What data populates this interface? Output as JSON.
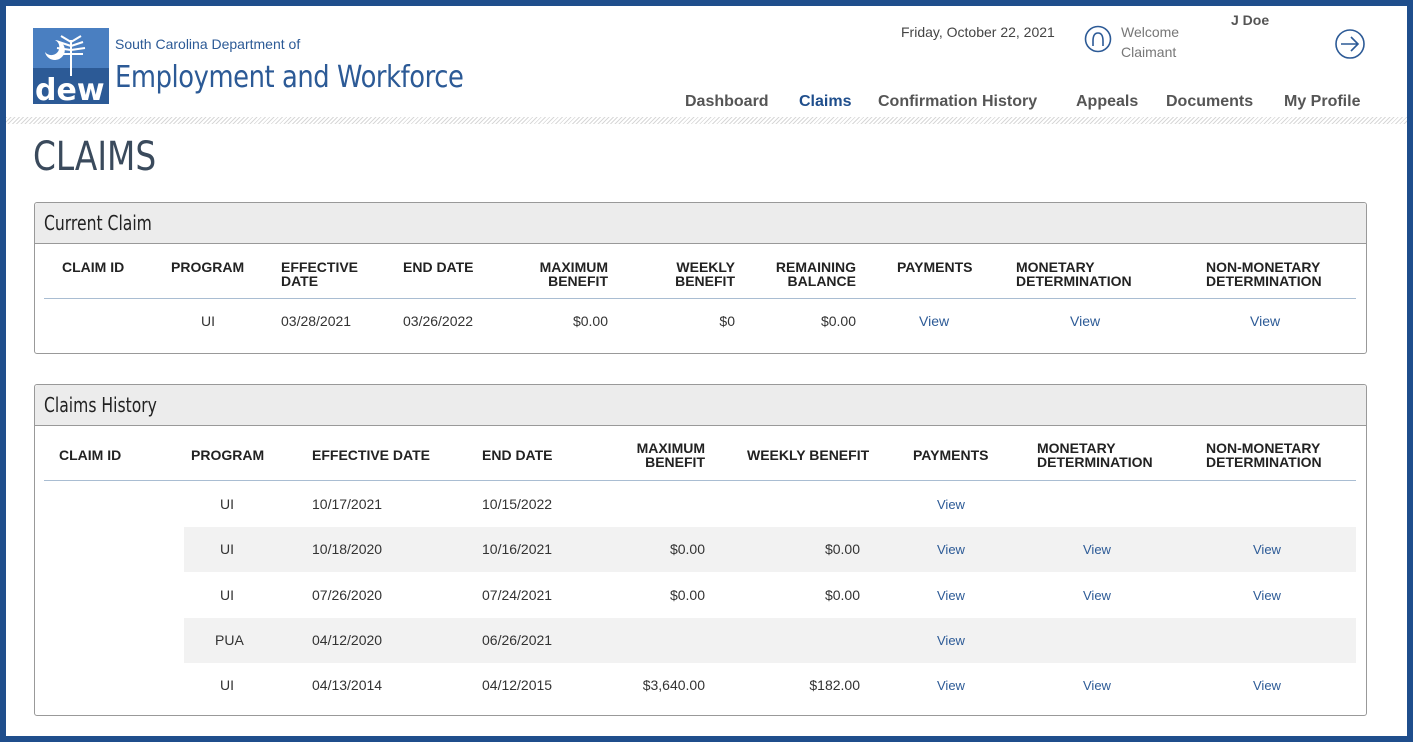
{
  "header": {
    "agency_line1": "South Carolina Department of",
    "agency_line2": "Employment and Workforce",
    "logo_text": "dew",
    "date": "Friday, October 22, 2021",
    "welcome": "Welcome",
    "role": "Claimant",
    "username": "J Doe",
    "icons": {
      "user": "user-circle-icon",
      "logout": "logout-arrow-icon"
    }
  },
  "nav": [
    {
      "label": "Dashboard",
      "active": false
    },
    {
      "label": "Claims",
      "active": true
    },
    {
      "label": "Confirmation History",
      "active": false
    },
    {
      "label": "Appeals",
      "active": false
    },
    {
      "label": "Documents",
      "active": false
    },
    {
      "label": "My Profile",
      "active": false
    }
  ],
  "page_title": "CLAIMS",
  "current_claim": {
    "title": "Current Claim",
    "headers": [
      "CLAIM ID",
      "PROGRAM",
      "EFFECTIVE DATE",
      "END DATE",
      "MAXIMUM BENEFIT",
      "WEEKLY BENEFIT",
      "REMAINING BALANCE",
      "PAYMENTS",
      "MONETARY DETERMINATION",
      "NON-MONETARY DETERMINATION"
    ],
    "header_lines": {
      "effective": [
        "EFFECTIVE",
        "DATE"
      ],
      "maximum": [
        "MAXIMUM",
        "BENEFIT"
      ],
      "weekly": [
        "WEEKLY",
        "BENEFIT"
      ],
      "remaining": [
        "REMAINING",
        "BALANCE"
      ],
      "monetary": [
        "MONETARY",
        "DETERMINATION"
      ],
      "nonmonetary": [
        "NON-MONETARY",
        "DETERMINATION"
      ]
    },
    "row": {
      "claim_id": "",
      "program": "UI",
      "effective_date": "03/28/2021",
      "end_date": "03/26/2022",
      "maximum_benefit": "$0.00",
      "weekly_benefit": "$0",
      "remaining_balance": "$0.00",
      "payments": "View",
      "monetary": "View",
      "nonmonetary": "View"
    }
  },
  "claims_history": {
    "title": "Claims History",
    "headers": {
      "claim_id": "CLAIM ID",
      "program": "PROGRAM",
      "effective": "EFFECTIVE DATE",
      "end": "END DATE",
      "maximum": [
        "MAXIMUM",
        "BENEFIT"
      ],
      "weekly": "WEEKLY BENEFIT",
      "payments": "PAYMENTS",
      "monetary": [
        "MONETARY",
        "DETERMINATION"
      ],
      "nonmonetary": [
        "NON-MONETARY",
        "DETERMINATION"
      ]
    },
    "rows": [
      {
        "program": "UI",
        "effective_date": "10/17/2021",
        "end_date": "10/15/2022",
        "maximum_benefit": "",
        "weekly_benefit": "",
        "payments": "View",
        "monetary": "",
        "nonmonetary": ""
      },
      {
        "program": "UI",
        "effective_date": "10/18/2020",
        "end_date": "10/16/2021",
        "maximum_benefit": "$0.00",
        "weekly_benefit": "$0.00",
        "payments": "View",
        "monetary": "View",
        "nonmonetary": "View"
      },
      {
        "program": "UI",
        "effective_date": "07/26/2020",
        "end_date": "07/24/2021",
        "maximum_benefit": "$0.00",
        "weekly_benefit": "$0.00",
        "payments": "View",
        "monetary": "View",
        "nonmonetary": "View"
      },
      {
        "program": "PUA",
        "effective_date": "04/12/2020",
        "end_date": "06/26/2021",
        "maximum_benefit": "",
        "weekly_benefit": "",
        "payments": "View",
        "monetary": "",
        "nonmonetary": ""
      },
      {
        "program": "UI",
        "effective_date": "04/13/2014",
        "end_date": "04/12/2015",
        "maximum_benefit": "$3,640.00",
        "weekly_benefit": "$182.00",
        "payments": "View",
        "monetary": "View",
        "nonmonetary": "View"
      }
    ]
  },
  "colors": {
    "brand": "#1f4e8c",
    "link": "#2c5a96",
    "panel_header": "#ececec",
    "row_stripe": "#f2f2f2"
  }
}
